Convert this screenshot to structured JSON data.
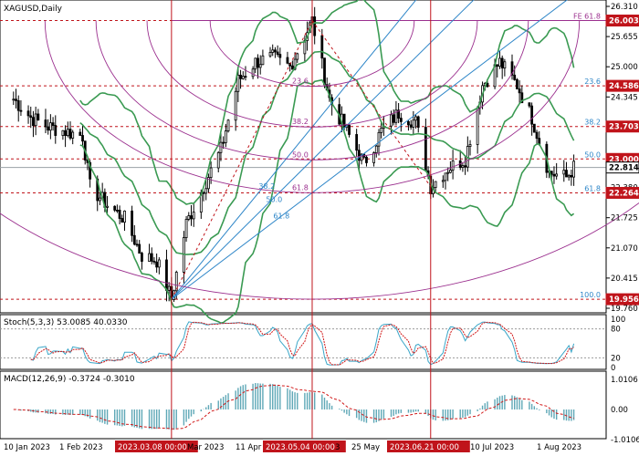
{
  "symbol_title": "XAGUSD,Daily",
  "colors": {
    "background": "#ffffff",
    "candle": "#000000",
    "bollinger": "#3a9a52",
    "level_line": "#c0141b",
    "fan_line": "#2e86c8",
    "fib_arc": "#9b2f8e",
    "price_tag": "#c0141b",
    "current_tag": "#ffffff",
    "macd_hist": "#5fa8b7",
    "macd_signal": "#d11a1a",
    "stoch_main": "#3aa6c8",
    "stoch_signal": "#d11a1a",
    "grid": "#d8d8d8"
  },
  "price_axis": {
    "ticks": [
      "26.310",
      "25.655",
      "25.000",
      "24.345",
      "23.690",
      "23.035",
      "22.380",
      "21.725",
      "21.070",
      "20.415",
      "19.760"
    ]
  },
  "price_tags": [
    {
      "value": "26.003",
      "kind": "level"
    },
    {
      "value": "24.586",
      "kind": "level"
    },
    {
      "value": "23.703",
      "kind": "level"
    },
    {
      "value": "23.000",
      "kind": "level"
    },
    {
      "value": "22.814",
      "kind": "current"
    },
    {
      "value": "22.264",
      "kind": "level"
    },
    {
      "value": "19.956",
      "kind": "level"
    }
  ],
  "fib_retracement_labels": [
    {
      "text": "FE 61.8",
      "value": 26.003
    },
    {
      "text": "23.6",
      "value": 24.586
    },
    {
      "text": "38.2",
      "value": 23.703
    },
    {
      "text": "50.0",
      "value": 23.0
    },
    {
      "text": "61.8",
      "value": 22.264
    },
    {
      "text": "100.0",
      "value": 19.956
    }
  ],
  "fib_arc_labels": [
    "23.6",
    "38.2",
    "50.0",
    "61.8"
  ],
  "fib_fan_labels": [
    "38.2",
    "50.0",
    "61.8"
  ],
  "x_axis": {
    "labels": [
      "10 Jan 2023",
      "1 Feb 2023",
      "2023.03.08 00:00",
      "Mar 2023",
      "11 Apr",
      "2023.05.04 00:00",
      "3",
      "25 May",
      "2023.06.21 00:00",
      "10 Jul 2023",
      "1 Aug 2023"
    ],
    "highlighted_labels": [
      "2023.03.08 00:00",
      "2023.05.04 00:00",
      "2023.06.21 00:00"
    ]
  },
  "stoch": {
    "title": "Stoch(5,3,3) 53.0085 40.0330",
    "ticks": [
      "100",
      "80",
      "20",
      "0"
    ]
  },
  "macd": {
    "title": "MACD(12,26,9) -0.3724 -0.3010",
    "ticks": [
      "1.0106",
      "0.00",
      "-1.0106"
    ]
  },
  "chart_data": {
    "type": "candlestick",
    "symbol": "XAGUSD",
    "timeframe": "Daily",
    "ylim": [
      19.76,
      26.31
    ],
    "current_price": 22.814,
    "horizontal_levels": [
      26.003,
      24.586,
      23.703,
      23.0,
      22.264,
      19.956
    ],
    "fib_extension_label": "FE 61.8",
    "close_path": [
      {
        "d": "2023-01-03",
        "c": 24.3
      },
      {
        "d": "2023-01-10",
        "c": 23.9
      },
      {
        "d": "2023-01-17",
        "c": 23.7
      },
      {
        "d": "2023-01-24",
        "c": 23.6
      },
      {
        "d": "2023-01-31",
        "c": 23.5
      },
      {
        "d": "2023-02-03",
        "c": 22.4
      },
      {
        "d": "2023-02-10",
        "c": 22.0
      },
      {
        "d": "2023-02-17",
        "c": 21.7
      },
      {
        "d": "2023-02-24",
        "c": 20.9
      },
      {
        "d": "2023-03-02",
        "c": 20.8
      },
      {
        "d": "2023-03-08",
        "c": 19.96
      },
      {
        "d": "2023-03-14",
        "c": 21.6
      },
      {
        "d": "2023-03-21",
        "c": 22.4
      },
      {
        "d": "2023-03-28",
        "c": 23.2
      },
      {
        "d": "2023-04-04",
        "c": 24.7
      },
      {
        "d": "2023-04-11",
        "c": 25.1
      },
      {
        "d": "2023-04-18",
        "c": 25.2
      },
      {
        "d": "2023-04-25",
        "c": 25.0
      },
      {
        "d": "2023-05-04",
        "c": 26.0
      },
      {
        "d": "2023-05-11",
        "c": 24.3
      },
      {
        "d": "2023-05-18",
        "c": 23.6
      },
      {
        "d": "2023-05-25",
        "c": 22.9
      },
      {
        "d": "2023-06-01",
        "c": 23.6
      },
      {
        "d": "2023-06-08",
        "c": 24.0
      },
      {
        "d": "2023-06-15",
        "c": 23.8
      },
      {
        "d": "2023-06-21",
        "c": 22.4
      },
      {
        "d": "2023-06-28",
        "c": 22.8
      },
      {
        "d": "2023-07-05",
        "c": 23.0
      },
      {
        "d": "2023-07-12",
        "c": 24.6
      },
      {
        "d": "2023-07-19",
        "c": 25.1
      },
      {
        "d": "2023-07-26",
        "c": 24.6
      },
      {
        "d": "2023-08-01",
        "c": 23.9
      },
      {
        "d": "2023-08-08",
        "c": 22.7
      },
      {
        "d": "2023-08-15",
        "c": 22.6
      },
      {
        "d": "2023-08-18",
        "c": 22.81
      }
    ]
  }
}
